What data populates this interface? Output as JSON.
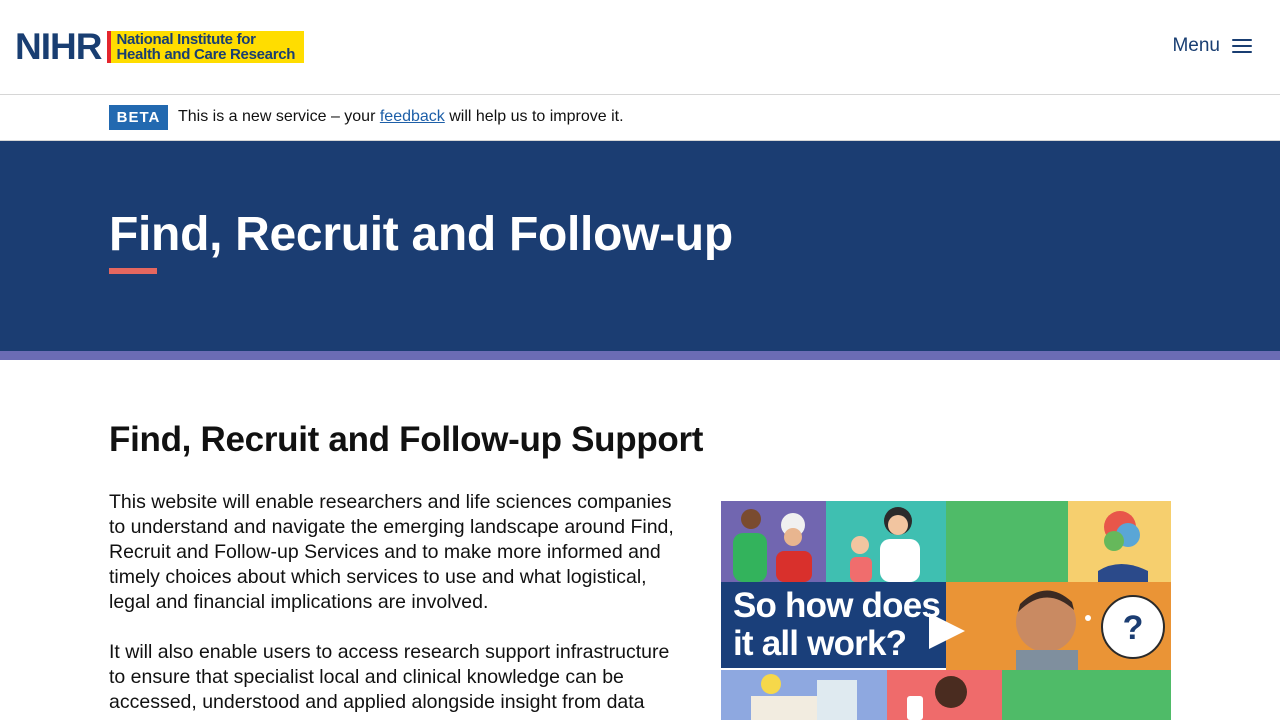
{
  "header": {
    "logo_mark": "NIHR",
    "logo_line1": "National Institute for",
    "logo_line2": "Health and Care Research",
    "menu_label": "Menu"
  },
  "beta_banner": {
    "tag": "BETA",
    "text_before": "This is a new service – your ",
    "link": "feedback",
    "text_after": " will help us to improve it."
  },
  "hero": {
    "title": "Find, Recruit and Follow-up"
  },
  "main": {
    "heading": "Find, Recruit and Follow-up Support",
    "paragraph1": "This website will enable researchers and life sciences companies to understand and navigate the emerging landscape around Find, Recruit and Follow-up Services and to make more informed and timely choices about which services to use and what logistical, legal and financial implications are involved.",
    "paragraph2": "It will also enable users to access research support infrastructure to ensure that specialist local and clinical knowledge can be accessed, understood and applied alongside insight from data"
  },
  "video": {
    "caption_line1": "So how does",
    "caption_line2": "it all work?",
    "icon": "play-icon"
  },
  "colors": {
    "navy": "#1b3d72",
    "accent_red": "#e5675f",
    "stripe_purple": "#6b6cb4",
    "logo_yellow": "#ffdd00",
    "beta_blue": "#2269b0",
    "link_blue": "#1d5fa8"
  }
}
